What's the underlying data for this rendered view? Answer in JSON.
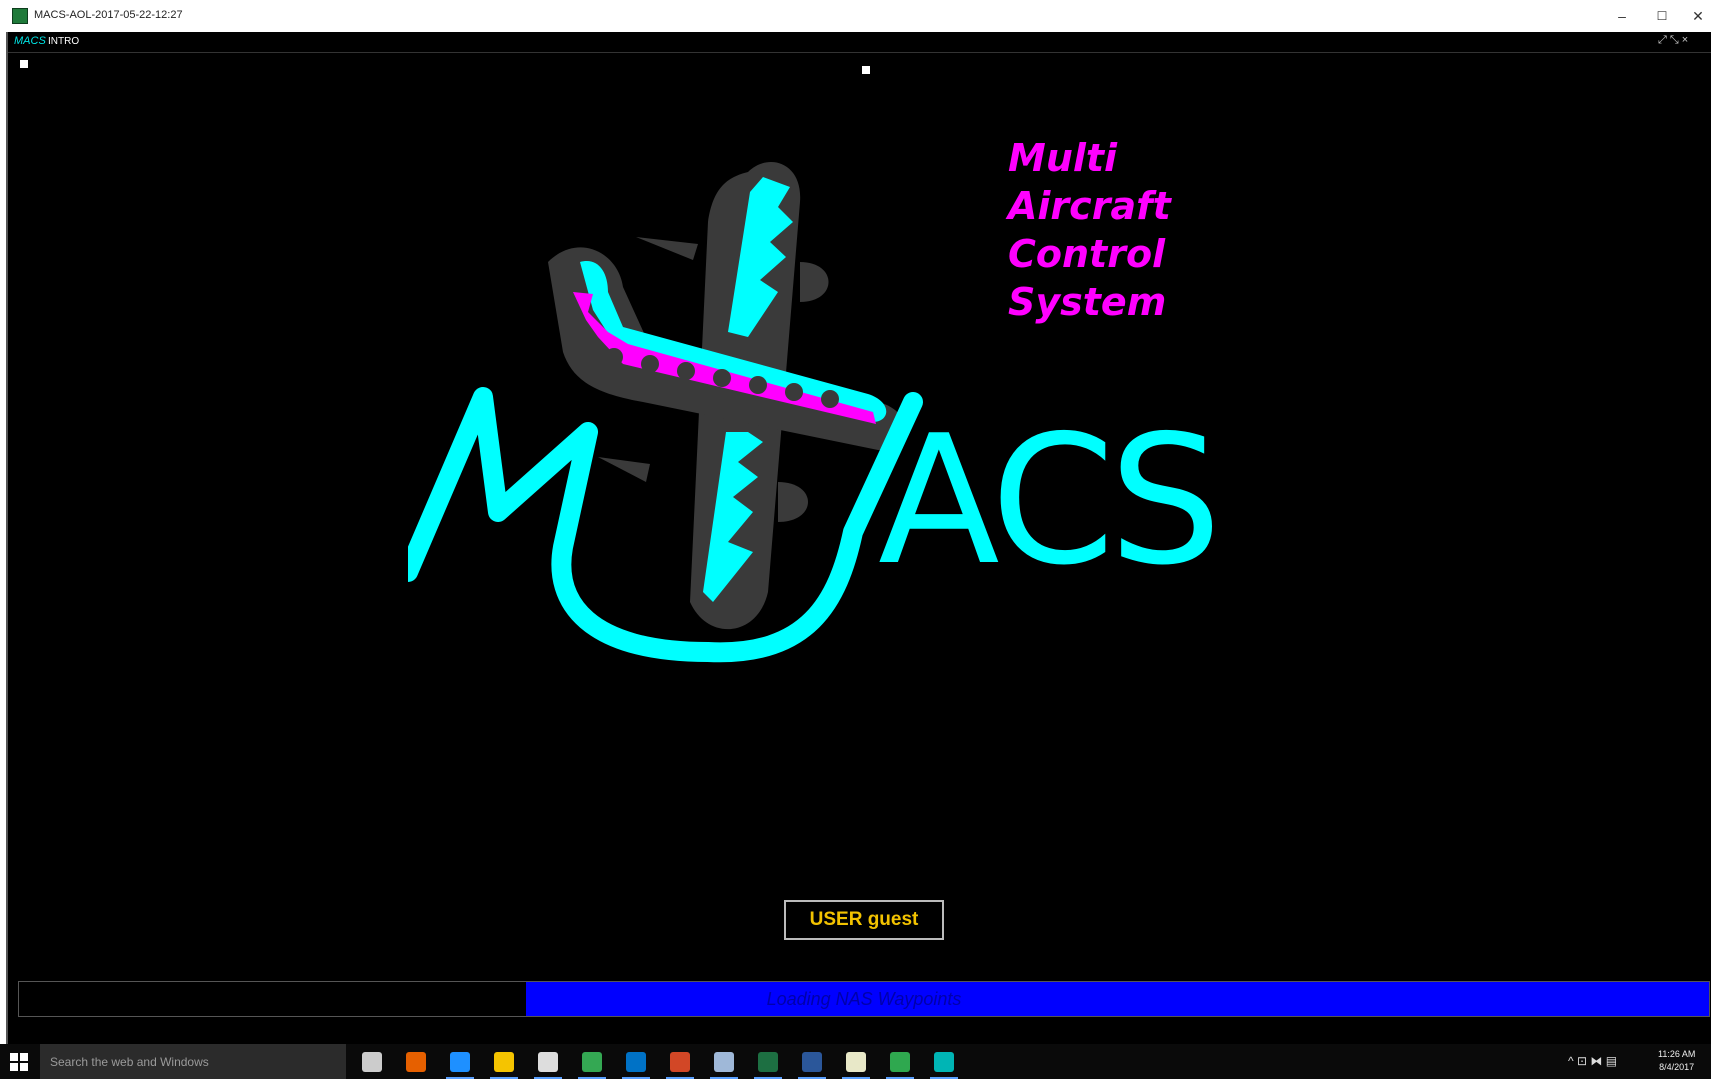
{
  "titlebar": {
    "title": "MACS-AOL-2017-05-22-12:27",
    "min": "–",
    "max": "☐",
    "close": "✕"
  },
  "inner_bar": {
    "logo": "MACS",
    "name": "INTRO",
    "corner_icons": "⤢ ⤡ ×"
  },
  "splash": {
    "lines": [
      "Multi",
      "Aircraft",
      "Control",
      "System"
    ],
    "logo_letters": "ACS",
    "colors": {
      "cyan": "#00ffff",
      "magenta": "#ff00ff",
      "gray": "#3a3a3a"
    }
  },
  "user_button": {
    "label": "USER guest"
  },
  "progress": {
    "label": "Loading NAS Waypoints",
    "fraction": 0.7,
    "color": "#0000ff"
  },
  "taskbar": {
    "search_placeholder": "Search the web and Windows",
    "apps": [
      {
        "name": "task-view-icon",
        "color": "#cccccc"
      },
      {
        "name": "firefox-icon",
        "color": "#e66000"
      },
      {
        "name": "edge-icon",
        "color": "#1e90ff"
      },
      {
        "name": "file-explorer-icon",
        "color": "#f5c400"
      },
      {
        "name": "store-icon",
        "color": "#dddddd"
      },
      {
        "name": "chrome-icon",
        "color": "#34a853"
      },
      {
        "name": "outlook-icon",
        "color": "#0072c6"
      },
      {
        "name": "powerpoint-icon",
        "color": "#d24726"
      },
      {
        "name": "app-icon",
        "color": "#9fb8d8"
      },
      {
        "name": "excel-icon",
        "color": "#1d6f42"
      },
      {
        "name": "word-icon",
        "color": "#2b579a"
      },
      {
        "name": "notepad-icon",
        "color": "#e8e8c8"
      },
      {
        "name": "image-app-icon",
        "color": "#2fa84f"
      },
      {
        "name": "macs-icon",
        "color": "#00b5b5"
      }
    ],
    "tray": "^ ⊡ ⧓ ▤",
    "time": "11:26 AM",
    "date": "8/4/2017"
  }
}
